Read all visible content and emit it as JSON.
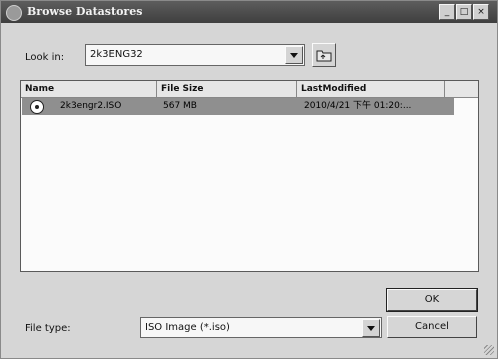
{
  "window": {
    "title": "Browse Datastores",
    "controls": [
      "_",
      "□",
      "×"
    ]
  },
  "lookin": {
    "label": "Look in:",
    "value": "2k3ENG32"
  },
  "columns": [
    "Name",
    "File Size",
    "LastModified"
  ],
  "files": [
    {
      "name": "2k3engr2.ISO",
      "size": "567 MB",
      "modified": "2010/4/21 下午 01:20:..."
    }
  ],
  "buttons": {
    "ok": "OK",
    "cancel": "Cancel"
  },
  "filetype": {
    "label": "File type:",
    "value": "ISO Image (*.iso)"
  }
}
